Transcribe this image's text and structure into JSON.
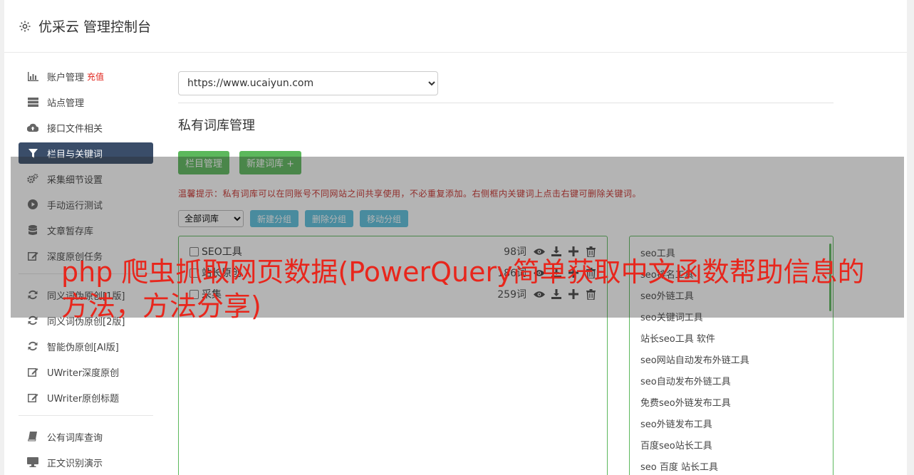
{
  "header": {
    "title": "优采云 管理控制台"
  },
  "sidebar": {
    "items": [
      {
        "label": "账户管理",
        "badge": "充值",
        "icon": "bar-chart-icon"
      },
      {
        "label": "站点管理",
        "icon": "server-icon"
      },
      {
        "label": "接口文件相关",
        "icon": "cloud-upload-icon"
      },
      {
        "label": "栏目与关键词",
        "icon": "filter-icon",
        "active": true
      },
      {
        "label": "采集细节设置",
        "icon": "gears-icon"
      },
      {
        "label": "手动运行测试",
        "icon": "play-circle-icon"
      },
      {
        "label": "文章暂存库",
        "icon": "database-icon"
      },
      {
        "label": "深度原创任务",
        "icon": "edit-icon"
      },
      {
        "label": "同义词伪原创[1版]",
        "icon": "refresh-icon"
      },
      {
        "label": "同义词伪原创[2版]",
        "icon": "refresh-icon"
      },
      {
        "label": "智能伪原创[AI版]",
        "icon": "refresh-icon"
      },
      {
        "label": "UWriter深度原创",
        "icon": "edit-icon"
      },
      {
        "label": "UWriter原创标题",
        "icon": "edit-icon"
      },
      {
        "label": "公有词库查询",
        "icon": "book-icon"
      },
      {
        "label": "正文识别演示",
        "icon": "monitor-icon"
      }
    ]
  },
  "main": {
    "site_select": "https://www.ucaiyun.com",
    "page_title": "私有词库管理",
    "btn_column": "栏目管理",
    "btn_new_lib": "新建词库 +",
    "tip": "温馨提示：私有词库可以在同账号不同网站之间共享使用，不必重复添加。右侧框内关键词上点击右键可删除关键词。",
    "group_select": "全部词库",
    "btn_new_group": "新建分组",
    "btn_delete_group": "删除分组",
    "btn_move_group": "移动分组",
    "libraries": [
      {
        "name": "SEO工具",
        "count": "98词"
      },
      {
        "name": "站长原创",
        "count": "186词"
      },
      {
        "name": "采集",
        "count": "259词"
      }
    ],
    "keywords": [
      "seo工具",
      "seo排名工具",
      "seo外链工具",
      "seo关键词工具",
      "站长seo工具 软件",
      "seo网站自动发布外链工具",
      "seo自动发布外链工具",
      "免费seo外链发布工具",
      "seo外链发布工具",
      "百度seo站长工具",
      "seo 百度 站长工具"
    ]
  },
  "overlay_title": "php 爬虫抓取网页数据(PowerQuery简单获取中文函数帮助信息的方法，方法分享)",
  "colors": {
    "accent_green": "#5cb85c",
    "info_blue": "#5bc0de",
    "active_nav": "#3a4d69",
    "alert_red": "#e0251d"
  }
}
